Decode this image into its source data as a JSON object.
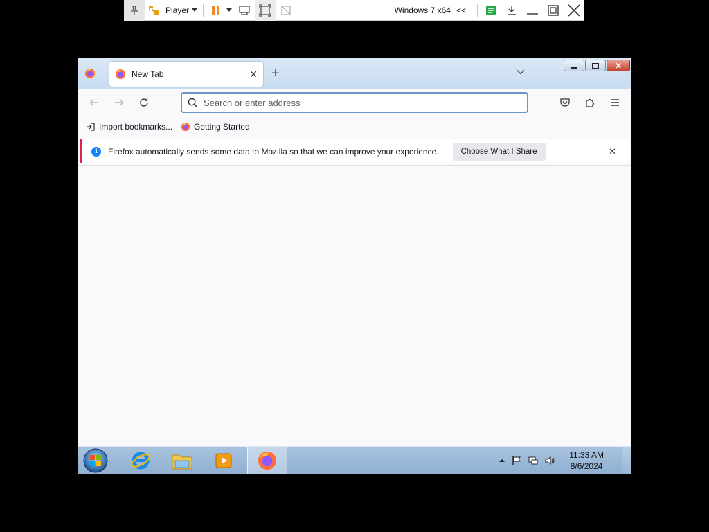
{
  "vm_toolbar": {
    "player_label": "Player",
    "vm_name": "Windows 7 x64",
    "collapse_glyph": "<<",
    "icons": [
      "pin-icon",
      "unity-icon",
      "pause-icon",
      "send-ctrl-alt-del-icon",
      "fullscreen-icon",
      "unity-mode-icon",
      "notes-icon",
      "download-icon",
      "minimize-icon",
      "restore-icon",
      "close-icon"
    ]
  },
  "firefox": {
    "tab": {
      "title": "New Tab",
      "close_glyph": "✕"
    },
    "new_tab_glyph": "+",
    "urlbar": {
      "placeholder": "Search or enter address",
      "value": ""
    },
    "bookmarks": [
      {
        "label": "Import bookmarks...",
        "icon": "import-icon"
      },
      {
        "label": "Getting Started",
        "icon": "firefox-icon"
      }
    ],
    "notification": {
      "message": "Firefox automatically sends some data to Mozilla so that we can improve your experience.",
      "button": "Choose What I Share",
      "info_glyph": "i",
      "close_glyph": "✕"
    },
    "colors": {
      "accent": "#0a84ff",
      "notif_border": "#d7264b"
    }
  },
  "taskbar": {
    "time": "11:33 AM",
    "date": "8/6/2024",
    "items": [
      "internet-explorer-icon",
      "windows-explorer-icon",
      "media-player-icon",
      "firefox-icon"
    ]
  }
}
